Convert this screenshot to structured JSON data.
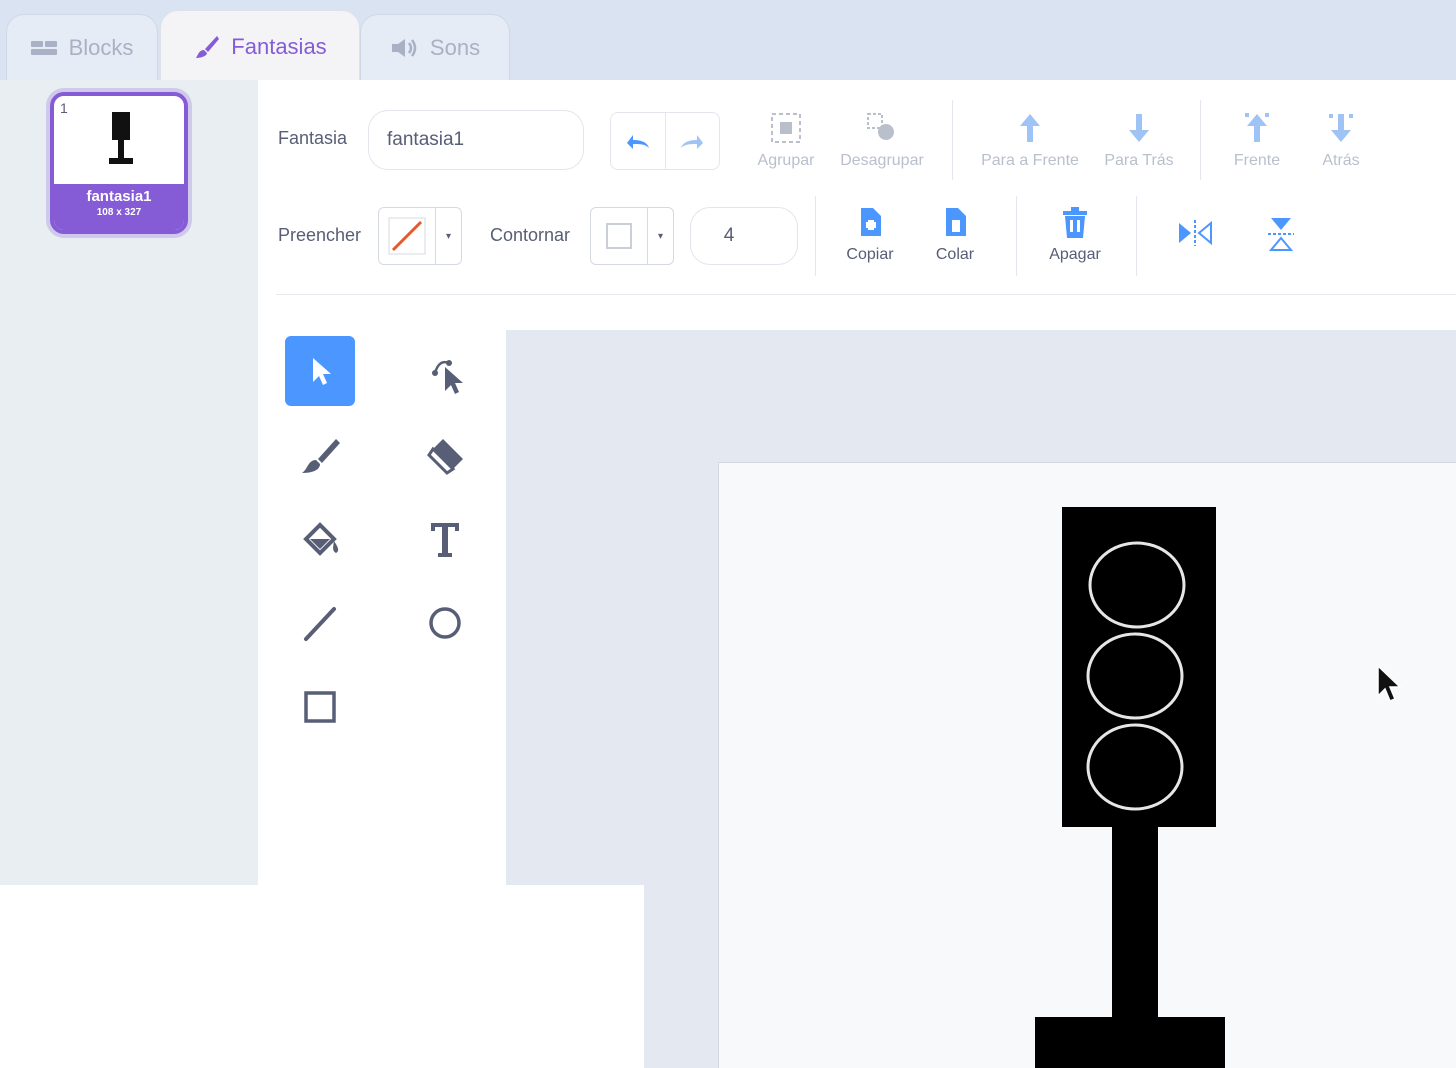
{
  "tabs": [
    {
      "label": "Blocks",
      "icon": "code-blocks-icon",
      "active": false
    },
    {
      "label": "Fantasias",
      "icon": "brush-icon",
      "active": true
    },
    {
      "label": "Sons",
      "icon": "speaker-icon",
      "active": false
    }
  ],
  "costumes": [
    {
      "number": "1",
      "name": "fantasia1",
      "size": "108 x 327",
      "selected": true
    }
  ],
  "toolbar": {
    "costume_label": "Fantasia",
    "costume_name": "fantasia1",
    "group": "Agrupar",
    "ungroup": "Desagrupar",
    "forward": "Para a Frente",
    "backward": "Para Trás",
    "front": "Frente",
    "back": "Atrás",
    "fill_label": "Preencher",
    "outline_label": "Contornar",
    "outline_width": "4",
    "copy": "Copiar",
    "paste": "Colar",
    "delete": "Apagar"
  },
  "colors": {
    "accent": "#855cd6",
    "tool_selected": "#4c97ff",
    "icon_blue": "#4c97ff",
    "text": "#575e75"
  },
  "tools": [
    "select",
    "reshape",
    "brush",
    "eraser",
    "fill",
    "text",
    "line",
    "circle",
    "rectangle"
  ],
  "selected_tool": "select"
}
